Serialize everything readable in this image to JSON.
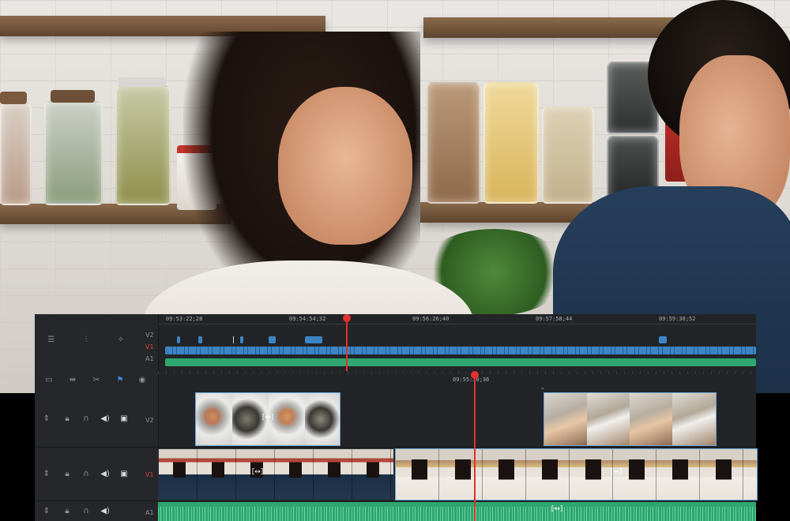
{
  "timecode": {
    "ruler_top": [
      "09:53:22;28",
      "09:54:54;32",
      "09:56:26;40",
      "09:57:58;44",
      "09:59:30;52"
    ],
    "playhead_lower": "09:55:38;36"
  },
  "upper_tracks": [
    "V2",
    "V1",
    "A1"
  ],
  "lower_tracks": {
    "v2": "V2",
    "v1": "V1",
    "a1": "A1"
  },
  "toolbar_icons": [
    "filmstrip-icon",
    "trim-icon",
    "blade-icon",
    "flag-icon",
    "view-icon"
  ],
  "upper_header_icons": [
    "clip-select-icon",
    "audio-tools-icon",
    "smart-icon"
  ],
  "track_header_icons": [
    "updown-icon",
    "lock-icon",
    "headphones-icon",
    "speaker-icon",
    "monitor-icon"
  ],
  "colors": {
    "panel": "#232428",
    "clip_blue": "#3b85c4",
    "audio_green": "#2da76f",
    "playhead": "#e3322d",
    "active_track": "#e2443c"
  },
  "clip_marker": "[↔]"
}
